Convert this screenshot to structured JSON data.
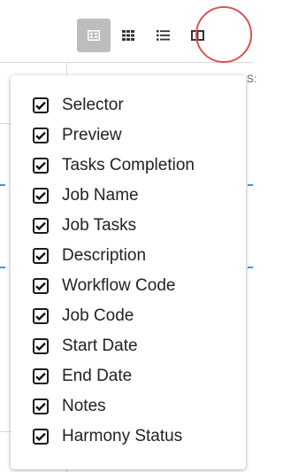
{
  "toolbar": {
    "buttons": [
      {
        "icon": "card-view-icon",
        "active": true
      },
      {
        "icon": "grid-view-icon",
        "active": false
      },
      {
        "icon": "list-view-icon",
        "active": false
      },
      {
        "icon": "columns-icon",
        "active": false
      }
    ],
    "highlight_color": "#d9534f"
  },
  "column_menu": {
    "items": [
      {
        "label": "Selector",
        "checked": true
      },
      {
        "label": "Preview",
        "checked": true
      },
      {
        "label": "Tasks Completion",
        "checked": true
      },
      {
        "label": "Job Name",
        "checked": true
      },
      {
        "label": "Job Tasks",
        "checked": true
      },
      {
        "label": "Description",
        "checked": true
      },
      {
        "label": "Workflow Code",
        "checked": true
      },
      {
        "label": "Job Code",
        "checked": true
      },
      {
        "label": "Start Date",
        "checked": true
      },
      {
        "label": "End Date",
        "checked": true
      },
      {
        "label": "Notes",
        "checked": true
      },
      {
        "label": "Harmony Status",
        "checked": true
      }
    ]
  },
  "background": {
    "truncated_text": "S:"
  }
}
